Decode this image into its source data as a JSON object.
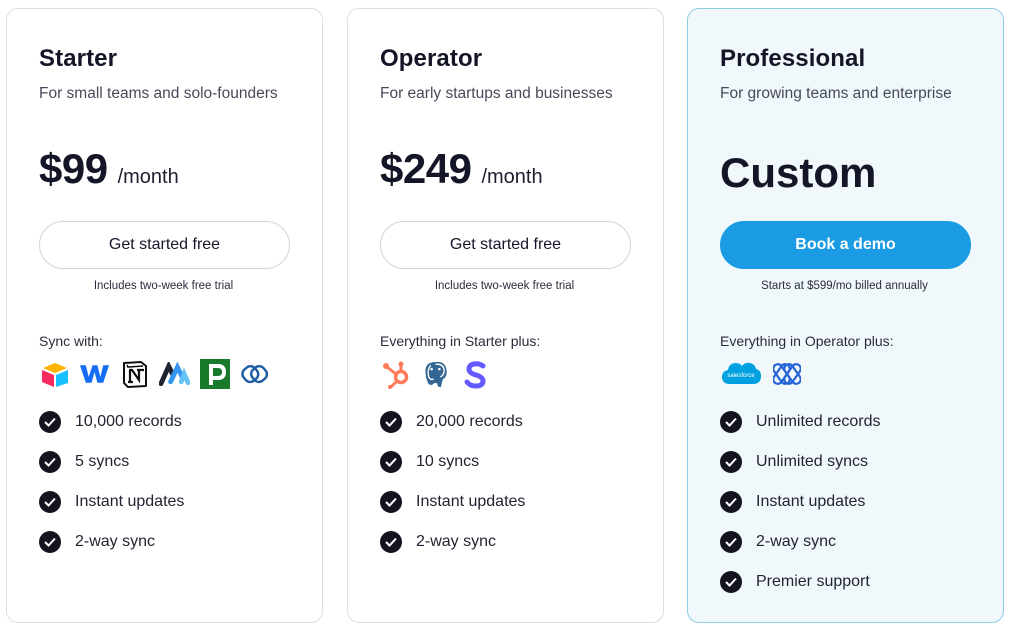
{
  "plans": [
    {
      "title": "Starter",
      "subtitle": "For small teams and solo-founders",
      "price": "$99",
      "period": "/month",
      "button": "Get started free",
      "note": "Includes two-week free trial",
      "sync_label": "Sync with:",
      "logos": [
        "airtable-icon",
        "webflow-icon",
        "notion-icon",
        "memberstack-icon",
        "pipedrive-icon",
        "zoho-icon"
      ],
      "features": [
        "10,000 records",
        "5 syncs",
        "Instant updates",
        "2-way sync"
      ]
    },
    {
      "title": "Operator",
      "subtitle": "For early startups and businesses",
      "price": "$249",
      "period": "/month",
      "button": "Get started free",
      "note": "Includes two-week free trial",
      "sync_label": "Everything in Starter plus:",
      "logos": [
        "hubspot-icon",
        "postgresql-icon",
        "stripe-icon"
      ],
      "features": [
        "20,000 records",
        "10 syncs",
        "Instant updates",
        "2-way sync"
      ]
    },
    {
      "title": "Professional",
      "subtitle": "For growing teams and enterprise",
      "price_text": "Custom",
      "button": "Book a demo",
      "note": "Starts at $599/mo billed annually",
      "sync_label": "Everything in Operator plus:",
      "logos": [
        "salesforce-icon",
        "dynamics-icon"
      ],
      "logo_texts": {
        "salesforce": "salesforce"
      },
      "features": [
        "Unlimited records",
        "Unlimited syncs",
        "Instant updates",
        "2-way sync",
        "Premier support"
      ]
    }
  ],
  "colors": {
    "accent": "#1a9be3",
    "pro_card_bg": "#f1f8fc",
    "pro_card_border": "#8ccde6",
    "check_bg": "#131420"
  }
}
